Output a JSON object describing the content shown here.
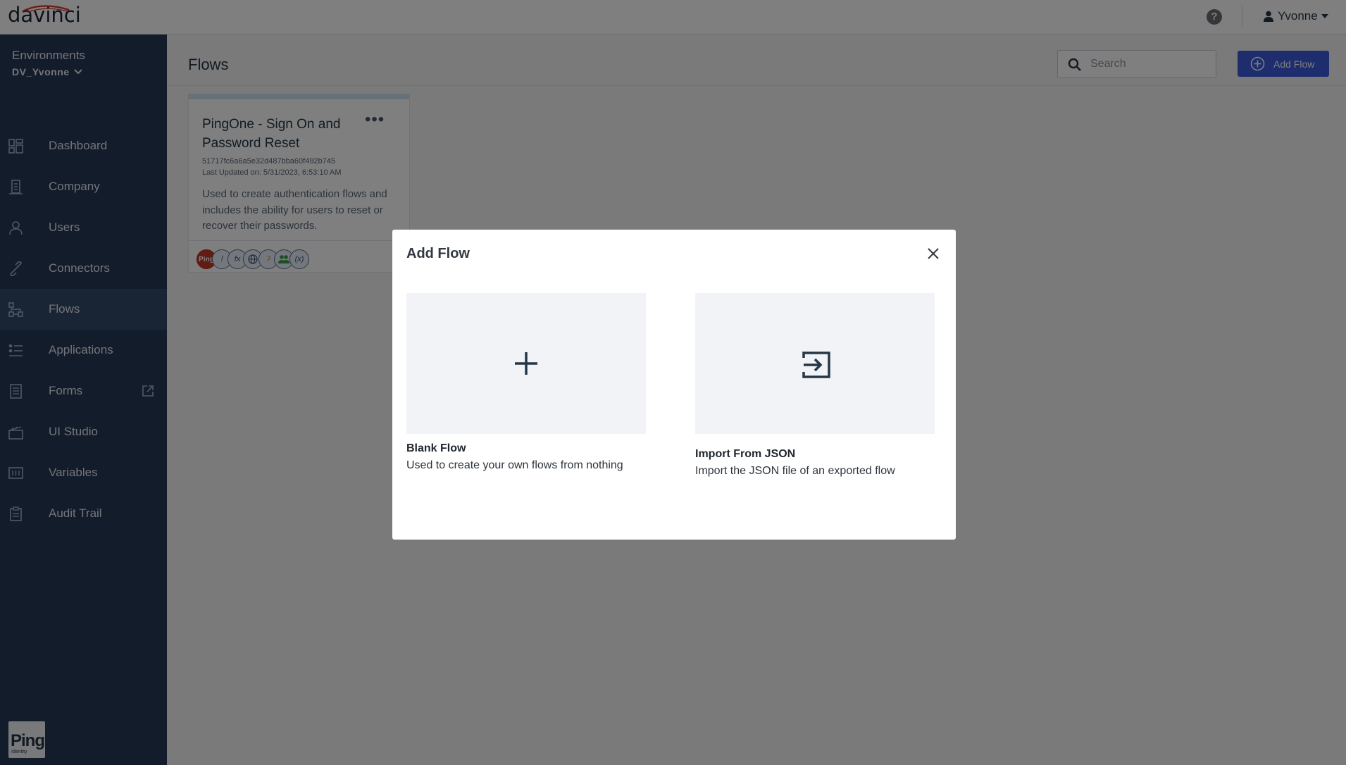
{
  "topbar": {
    "logo": "davinci",
    "help": "?",
    "user_name": "Yvonne"
  },
  "sidebar": {
    "env_label": "Environments",
    "env_value": "DV_Yvonne",
    "items": [
      {
        "label": "Dashboard",
        "icon": "dashboard-icon"
      },
      {
        "label": "Company",
        "icon": "building-icon"
      },
      {
        "label": "Users",
        "icon": "user-icon"
      },
      {
        "label": "Connectors",
        "icon": "link-icon"
      },
      {
        "label": "Flows",
        "icon": "flow-icon",
        "active": true
      },
      {
        "label": "Applications",
        "icon": "applications-icon"
      },
      {
        "label": "Forms",
        "icon": "form-icon"
      },
      {
        "label": "UI Studio",
        "icon": "ui-studio-icon"
      },
      {
        "label": "Variables",
        "icon": "variables-icon"
      },
      {
        "label": "Audit Trail",
        "icon": "clipboard-icon"
      }
    ],
    "footer_logo": "Ping",
    "footer_logo_sub": "Identity"
  },
  "main": {
    "title": "Flows",
    "search_placeholder": "Search",
    "add_button_label": "Add Flow",
    "card": {
      "title": "PingOne - Sign On and Password Reset",
      "id": "51717fc6a6a5e32d487bba60f492b745",
      "updated": "Last Updated on: 5/31/2023, 6:53:10 AM",
      "description": "Used to create authentication flows and includes the ability for users to reset or recover their passwords.",
      "connectors": [
        "Ping",
        "!",
        "fx",
        "globe",
        "ʔ",
        "users",
        "(x)"
      ]
    }
  },
  "modal": {
    "title": "Add Flow",
    "options": [
      {
        "title": "Blank Flow",
        "description": "Used to create your own flows from nothing",
        "icon": "plus-icon"
      },
      {
        "title": "Import From JSON",
        "description": "Import the JSON file of an exported flow",
        "icon": "import-icon"
      }
    ]
  },
  "colors": {
    "sidebar_bg": "#263956",
    "primary_button": "#3b5bdb",
    "overlay": "rgba(0,0,0,0.5)"
  }
}
